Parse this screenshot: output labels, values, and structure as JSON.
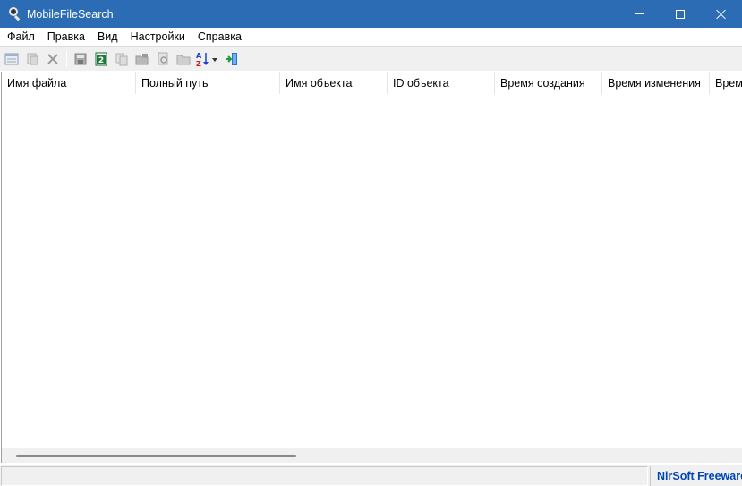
{
  "window": {
    "title": "MobileFileSearch"
  },
  "menu": [
    "Файл",
    "Правка",
    "Вид",
    "Настройки",
    "Справка"
  ],
  "toolbar": {
    "icons": [
      "properties-icon",
      "copy-selected-icon",
      "delete-icon",
      "save-icon",
      "excel-icon",
      "copy-icon",
      "open-folder-icon",
      "find-icon",
      "folder-icon",
      "sort-icon",
      "exit-icon"
    ]
  },
  "table": {
    "columns": [
      "Имя файла",
      "Полный путь",
      "Имя объекта",
      "ID объекта",
      "Время создания",
      "Время изменения",
      "Время"
    ]
  },
  "status": {
    "link": "NirSoft Freeware"
  },
  "colors": {
    "titlebar": "#2b6cb5",
    "link": "#0045b8"
  }
}
